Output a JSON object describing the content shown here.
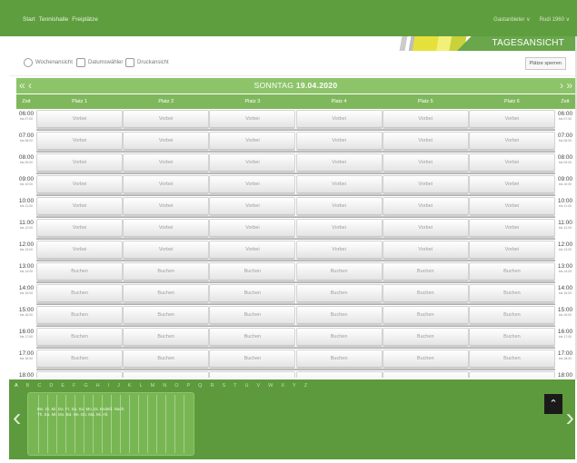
{
  "topnav": {
    "links": [
      "Start",
      "Tennishalle",
      "Freiplätze"
    ],
    "right": [
      "Gastanbieter ∨",
      "Rudi 1960 ∨"
    ]
  },
  "banner": {
    "tag": "TAGESANSICHT"
  },
  "toolbar": {
    "week_view": "Wochenansicht",
    "date_select": "Datumswähler",
    "print": "Druckansicht",
    "platz_button": "Plätze sperren"
  },
  "datebar": {
    "prev": "« ‹",
    "next": "› »",
    "day": "SONNTAG ",
    "date": "19.04.2020"
  },
  "table": {
    "time_header": "Zeit",
    "columns": [
      "Platz 1",
      "Platz 2",
      "Platz 3",
      "Platz 4",
      "Platz 5",
      "Platz 6"
    ],
    "rows": [
      {
        "time": "06:00",
        "sub": "bis 07:00",
        "status": "Vorbei"
      },
      {
        "time": "07:00",
        "sub": "bis 08:00",
        "status": "Vorbei"
      },
      {
        "time": "08:00",
        "sub": "bis 09:00",
        "status": "Vorbei"
      },
      {
        "time": "09:00",
        "sub": "bis 10:00",
        "status": "Vorbei"
      },
      {
        "time": "10:00",
        "sub": "bis 11:00",
        "status": "Vorbei"
      },
      {
        "time": "11:00",
        "sub": "bis 12:00",
        "status": "Vorbei"
      },
      {
        "time": "12:00",
        "sub": "bis 13:00",
        "status": "Vorbei"
      },
      {
        "time": "13:00",
        "sub": "bis 14:00",
        "status": "Buchen"
      },
      {
        "time": "14:00",
        "sub": "bis 15:00",
        "status": "Buchen"
      },
      {
        "time": "15:00",
        "sub": "bis 16:00",
        "status": "Buchen"
      },
      {
        "time": "16:00",
        "sub": "bis 17:00",
        "status": "Buchen"
      },
      {
        "time": "17:00",
        "sub": "bis 18:00",
        "status": "Buchen"
      },
      {
        "time": "18:00",
        "sub": "",
        "status": ""
      }
    ]
  },
  "alphabet": [
    "A",
    "B",
    "C",
    "D",
    "E",
    "F",
    "G",
    "H",
    "I",
    "J",
    "K",
    "L",
    "M",
    "N",
    "O",
    "P",
    "Q",
    "R",
    "S",
    "T",
    "U",
    "V",
    "W",
    "X",
    "Y",
    "Z"
  ],
  "bottom": {
    "line1": "Mo. Di. Mi. Do. Fr. Sa. So. Mo. Di. Endeß. Nach.",
    "line2": "Th. Ea. Mi. Mo. Bd. He. Do. Ma. Mi. All."
  },
  "colors": {
    "green_dark": "#5d9a3d",
    "green_mid": "#7fb85c",
    "green_light": "#8dc46a"
  }
}
